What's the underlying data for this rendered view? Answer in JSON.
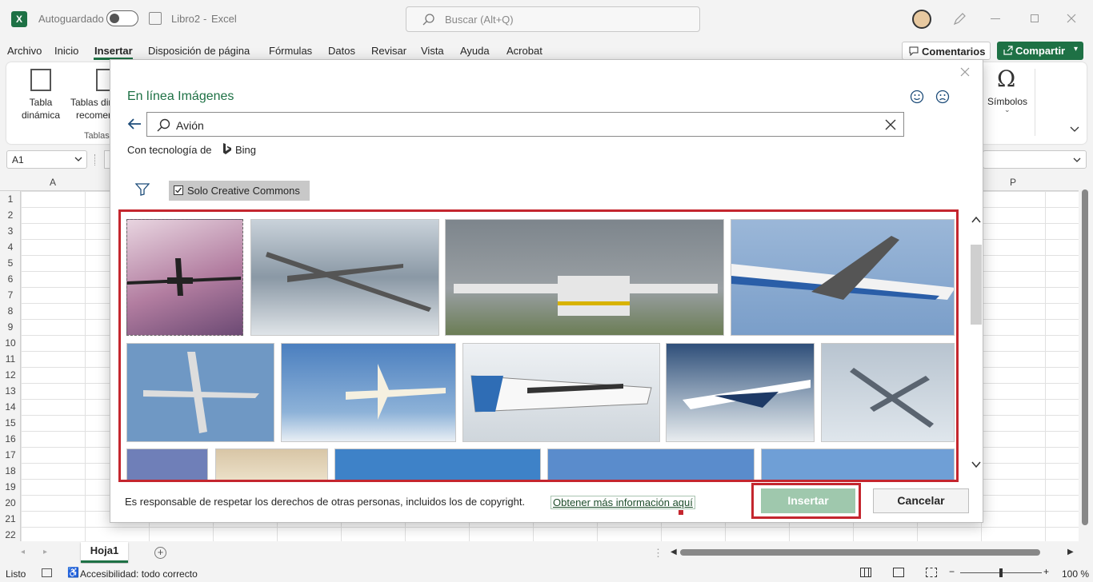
{
  "titlebar": {
    "autosave_label": "Autoguardado",
    "filename": "Libro2",
    "separator": "-",
    "app_name": "Excel",
    "search_placeholder": "Buscar (Alt+Q)"
  },
  "menu": {
    "items": [
      "Archivo",
      "Inicio",
      "Insertar",
      "Disposición de página",
      "Fórmulas",
      "Datos",
      "Revisar",
      "Vista",
      "Ayuda",
      "Acrobat"
    ],
    "active": "Insertar",
    "comments_label": "Comentarios",
    "share_label": "Compartir"
  },
  "ribbon": {
    "pivot_label_1": "Tabla",
    "pivot_label_2": "dinámica",
    "recommended_label_1": "Tablas din",
    "recommended_label_2": "recomen",
    "group_label": "Tablas",
    "symbols_label": "Símbolos"
  },
  "formula_bar": {
    "name_box": "A1"
  },
  "grid": {
    "columns": [
      "A",
      "P"
    ],
    "rows": [
      "1",
      "2",
      "3",
      "4",
      "5",
      "6",
      "7",
      "8",
      "9",
      "10",
      "11",
      "12",
      "13",
      "14",
      "15",
      "16",
      "17",
      "18",
      "19",
      "20",
      "21",
      "22"
    ]
  },
  "sheet": {
    "tab_name": "Hoja1"
  },
  "status": {
    "ready": "Listo",
    "accessibility": "Accesibilidad: todo correcto",
    "zoom": "100 %"
  },
  "dialog": {
    "title": "En línea Imágenes",
    "search_value": "Avión",
    "powered_by_prefix": "Con tecnología de",
    "powered_by_brand": "Bing",
    "cc_filter_label": "Solo Creative Commons",
    "footer_text": "Es responsable de respetar los derechos de otras personas, incluidos los de copyright.",
    "footer_link": "Obtener más información aquí",
    "insert_label": "Insertar",
    "cancel_label": "Cancelar"
  },
  "colors": {
    "excel_green": "#1e7145",
    "highlight_red": "#c4262e",
    "insert_disabled": "#9fc8ad"
  }
}
